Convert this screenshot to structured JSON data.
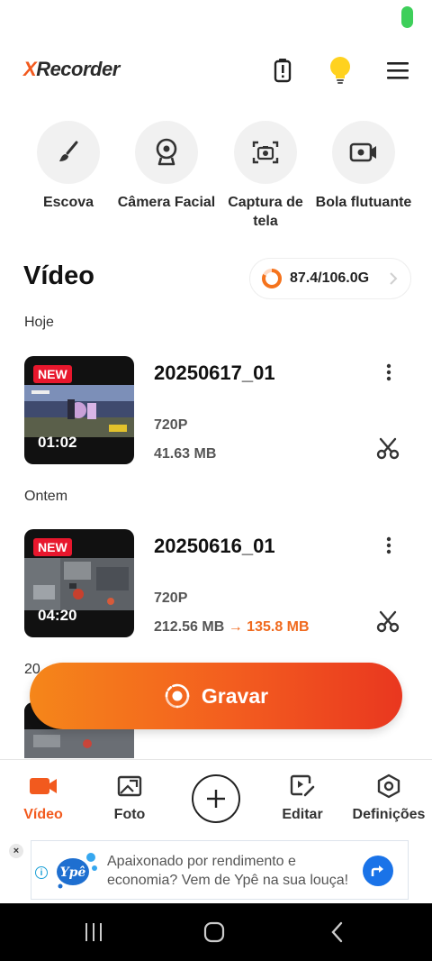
{
  "app": {
    "logo_x": "X",
    "logo_rest": "Recorder",
    "accent": "#F25A1E"
  },
  "tools": [
    {
      "label": "Escova",
      "icon": "brush-icon"
    },
    {
      "label": "Câmera Facial",
      "icon": "webcam-icon"
    },
    {
      "label": "Captura de tela",
      "icon": "screenshot-camera-icon"
    },
    {
      "label": "Bola flutuante",
      "icon": "floating-ball-camera-icon"
    }
  ],
  "videos_section": {
    "title": "Vídeo",
    "storage": "87.4/106.0G",
    "storage_used_fraction": 0.82
  },
  "groups": [
    {
      "label": "Hoje"
    },
    {
      "label": "Ontem"
    },
    {
      "label": "20"
    }
  ],
  "videos": [
    {
      "badge": "NEW",
      "duration": "01:02",
      "name": "20250617_01",
      "resolution": "720P",
      "size": "41.63 MB",
      "compressed_size": ""
    },
    {
      "badge": "NEW",
      "duration": "04:20",
      "name": "20250616_01",
      "resolution": "720P",
      "size": "212.56 MB",
      "arrow": "→",
      "compressed_size": "135.8 MB"
    }
  ],
  "record_button": {
    "label": "Gravar"
  },
  "bottom_nav": [
    {
      "label": "Vídeo",
      "icon": "video-camera-icon",
      "active": true
    },
    {
      "label": "Foto",
      "icon": "photo-icon",
      "active": false
    },
    {
      "label": "",
      "icon": "plus-icon",
      "active": false
    },
    {
      "label": "Editar",
      "icon": "edit-video-icon",
      "active": false
    },
    {
      "label": "Definições",
      "icon": "settings-hexagon-icon",
      "active": false
    }
  ],
  "ad": {
    "close": "×",
    "info": "i",
    "brand": "Ypê",
    "text": "Apaixonado por rendimento e economia? Vem de Ypê na sua louça!"
  }
}
